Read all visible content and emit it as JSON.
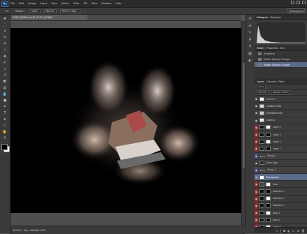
{
  "app": {
    "logo": "Ps"
  },
  "menu": [
    "File",
    "Edit",
    "Image",
    "Layer",
    "Type",
    "Select",
    "Filter",
    "3D",
    "View",
    "Window",
    "Help"
  ],
  "options": {
    "tool_label": "Feather:",
    "style_label": "Style:",
    "style_value": "Normal",
    "refine_label": "Refine Edge...",
    "workspace": "Photography"
  },
  "document": {
    "tab_title": "SHOE_DONE.psd @ 16.7% (RGB/8)"
  },
  "status": {
    "zoom": "16.67%",
    "doc": "Doc: 64.0M/1.34G"
  },
  "panels": {
    "top_tabs": [
      "Histogram",
      "Navigator"
    ],
    "history_tabs": [
      "History",
      "Properties",
      "Info"
    ],
    "history": [
      "Transform",
      "Master Opacity Change",
      "Master Opacity Change"
    ],
    "layers_tabs": [
      "Layers",
      "Channels",
      "Paths"
    ],
    "layer_kind": "Kind",
    "layer_blend": "Normal",
    "layer_opacity": "Opacity: 100%"
  },
  "layers": [
    {
      "name": "Curves 1",
      "eye": "none",
      "thumb": "#ffffff",
      "thumb2": null,
      "selected": false
    },
    {
      "name": "Gradient Map",
      "eye": "none",
      "thumb": "#dddddd",
      "thumb2": null,
      "selected": false
    },
    {
      "name": "Hue/Saturation",
      "eye": "none",
      "thumb": "#cccccc",
      "thumb2": null,
      "selected": false
    },
    {
      "name": "Levels 1",
      "eye": "none",
      "thumb": "#eeeeee",
      "thumb2": null,
      "selected": false
    },
    {
      "name": "Layer 4",
      "eye": "red",
      "thumb": "#111111",
      "thumb2": "#ffffff",
      "selected": false
    },
    {
      "name": "Layer 3",
      "eye": "red",
      "thumb": "#111111",
      "thumb2": "#000000",
      "selected": false
    },
    {
      "name": "Layer 2",
      "eye": "red",
      "thumb": "#111111",
      "thumb2": "#ffffff",
      "selected": false
    },
    {
      "name": "Layer 1",
      "eye": "red",
      "thumb": "#222222",
      "thumb2": "#000000",
      "selected": false
    },
    {
      "name": "Group 2",
      "eye": "blue",
      "thumb": null,
      "thumb2": null,
      "selected": false
    },
    {
      "name": "Shoe copy",
      "eye": "none",
      "thumb": "#2a2a2a",
      "thumb2": null,
      "selected": false
    },
    {
      "name": "Group 1",
      "eye": "blue",
      "thumb": null,
      "thumb2": null,
      "selected": false
    },
    {
      "name": "Background",
      "eye": "none",
      "thumb": "#ffffff",
      "thumb2": null,
      "selected": true
    },
    {
      "name": "Shoe",
      "eye": "red",
      "thumb": "#444444",
      "thumb2": "#ffffff",
      "selected": false
    },
    {
      "name": "Particles 1",
      "eye": "red",
      "thumb": "#111111",
      "thumb2": "#000000",
      "selected": false
    },
    {
      "name": "Particles 2",
      "eye": "red",
      "thumb": "#111111",
      "thumb2": "#ffffff",
      "selected": false
    },
    {
      "name": "Particles 3",
      "eye": "red",
      "thumb": "#111111",
      "thumb2": "#000000",
      "selected": false
    },
    {
      "name": "Dust 1",
      "eye": "red",
      "thumb": "#111111",
      "thumb2": "#ffffff",
      "selected": false
    },
    {
      "name": "Dust 2",
      "eye": "red",
      "thumb": "#111111",
      "thumb2": "#000000",
      "selected": false
    },
    {
      "name": "Layer 0",
      "eye": "red",
      "thumb": "#111111",
      "thumb2": "#ffffff",
      "selected": false
    }
  ],
  "tools": [
    "move-icon",
    "marquee-icon",
    "lasso-icon",
    "quick-select-icon",
    "crop-icon",
    "eyedropper-icon",
    "healing-icon",
    "brush-icon",
    "stamp-icon",
    "history-brush-icon",
    "eraser-icon",
    "gradient-icon",
    "blur-icon",
    "dodge-icon",
    "pen-icon",
    "type-icon",
    "path-select-icon",
    "shape-icon",
    "hand-icon",
    "zoom-icon"
  ],
  "colors": {
    "accent_selected": "#5a6a8a",
    "eye_red": "#8a2a2a",
    "eye_blue": "#3a4a7a"
  }
}
